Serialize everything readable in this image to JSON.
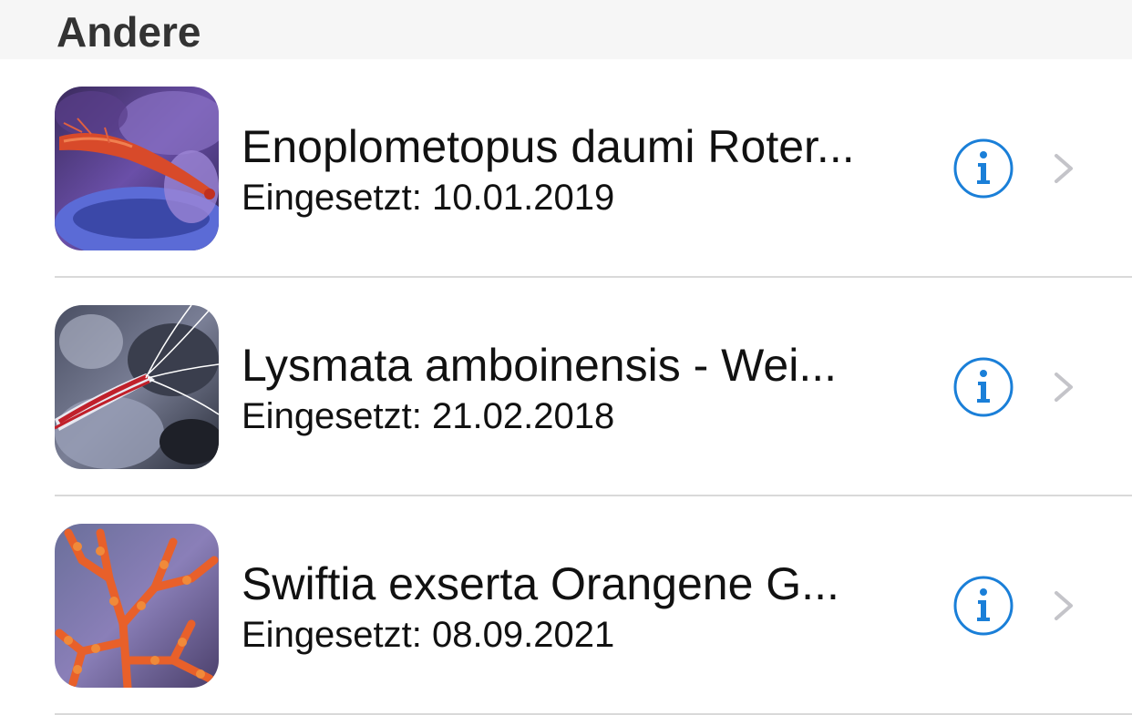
{
  "section": {
    "title": "Andere"
  },
  "items": [
    {
      "title": "Enoplometopus daumi Roter...",
      "subtitle": "Eingesetzt: 10.01.2019",
      "thumbnail": "red-reef-lobster-photo"
    },
    {
      "title": "Lysmata amboinensis - Wei...",
      "subtitle": "Eingesetzt: 21.02.2018",
      "thumbnail": "cleaner-shrimp-photo"
    },
    {
      "title": "Swiftia exserta Orangene G...",
      "subtitle": "Eingesetzt: 08.09.2021",
      "thumbnail": "orange-gorgonian-photo"
    }
  ],
  "colors": {
    "accent": "#1a7fd8",
    "chevron": "#c4c4c9",
    "separator": "#d9d9d9",
    "header_bg": "#f6f6f6"
  },
  "icons": {
    "info": "info-circle-icon",
    "disclosure": "chevron-right-icon"
  }
}
